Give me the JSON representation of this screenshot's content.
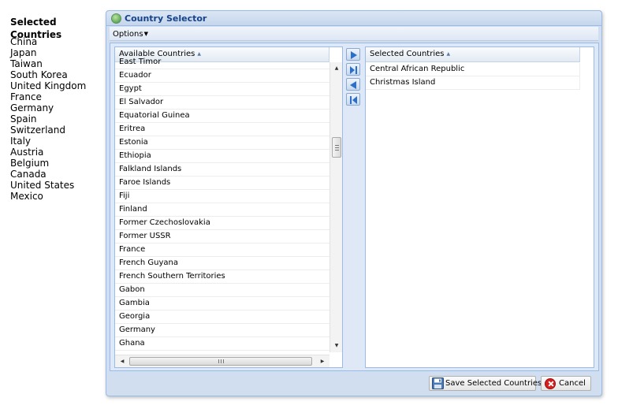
{
  "selected_panel": {
    "title": "Selected Countries",
    "countries": [
      "China",
      "Japan",
      "Taiwan",
      "South Korea",
      "United Kingdom",
      "France",
      "Germany",
      "Spain",
      "Switzerland",
      "Italy",
      "Austria",
      "Belgium",
      "Canada",
      "United States",
      "Mexico"
    ]
  },
  "window": {
    "title": "Country Selector",
    "menu_options": "Options",
    "available": {
      "header": "Available Countries",
      "rows": [
        "East Timor",
        "Ecuador",
        "Egypt",
        "El Salvador",
        "Equatorial Guinea",
        "Eritrea",
        "Estonia",
        "Ethiopia",
        "Falkland Islands",
        "Faroe Islands",
        "Fiji",
        "Finland",
        "Former Czechoslovakia",
        "Former USSR",
        "France",
        "French Guyana",
        "French Southern Territories",
        "Gabon",
        "Gambia",
        "Georgia",
        "Germany",
        "Ghana"
      ]
    },
    "selected": {
      "header": "Selected Countries",
      "rows": [
        "Central African Republic",
        "Christmas Island"
      ]
    },
    "buttons": {
      "save": "Save Selected Countries",
      "cancel": "Cancel"
    }
  },
  "icons": {
    "window": "globe-icon",
    "move_right": "arrow-right-icon",
    "move_all_right": "arrow-last-icon",
    "move_left": "arrow-left-icon",
    "move_all_left": "arrow-first-icon",
    "save": "save-disk-icon",
    "cancel": "cancel-x-icon"
  },
  "colors": {
    "title_text": "#15428b",
    "window_bg": "#d0def0",
    "border": "#99bbe8",
    "cancel_red": "#d42020"
  }
}
